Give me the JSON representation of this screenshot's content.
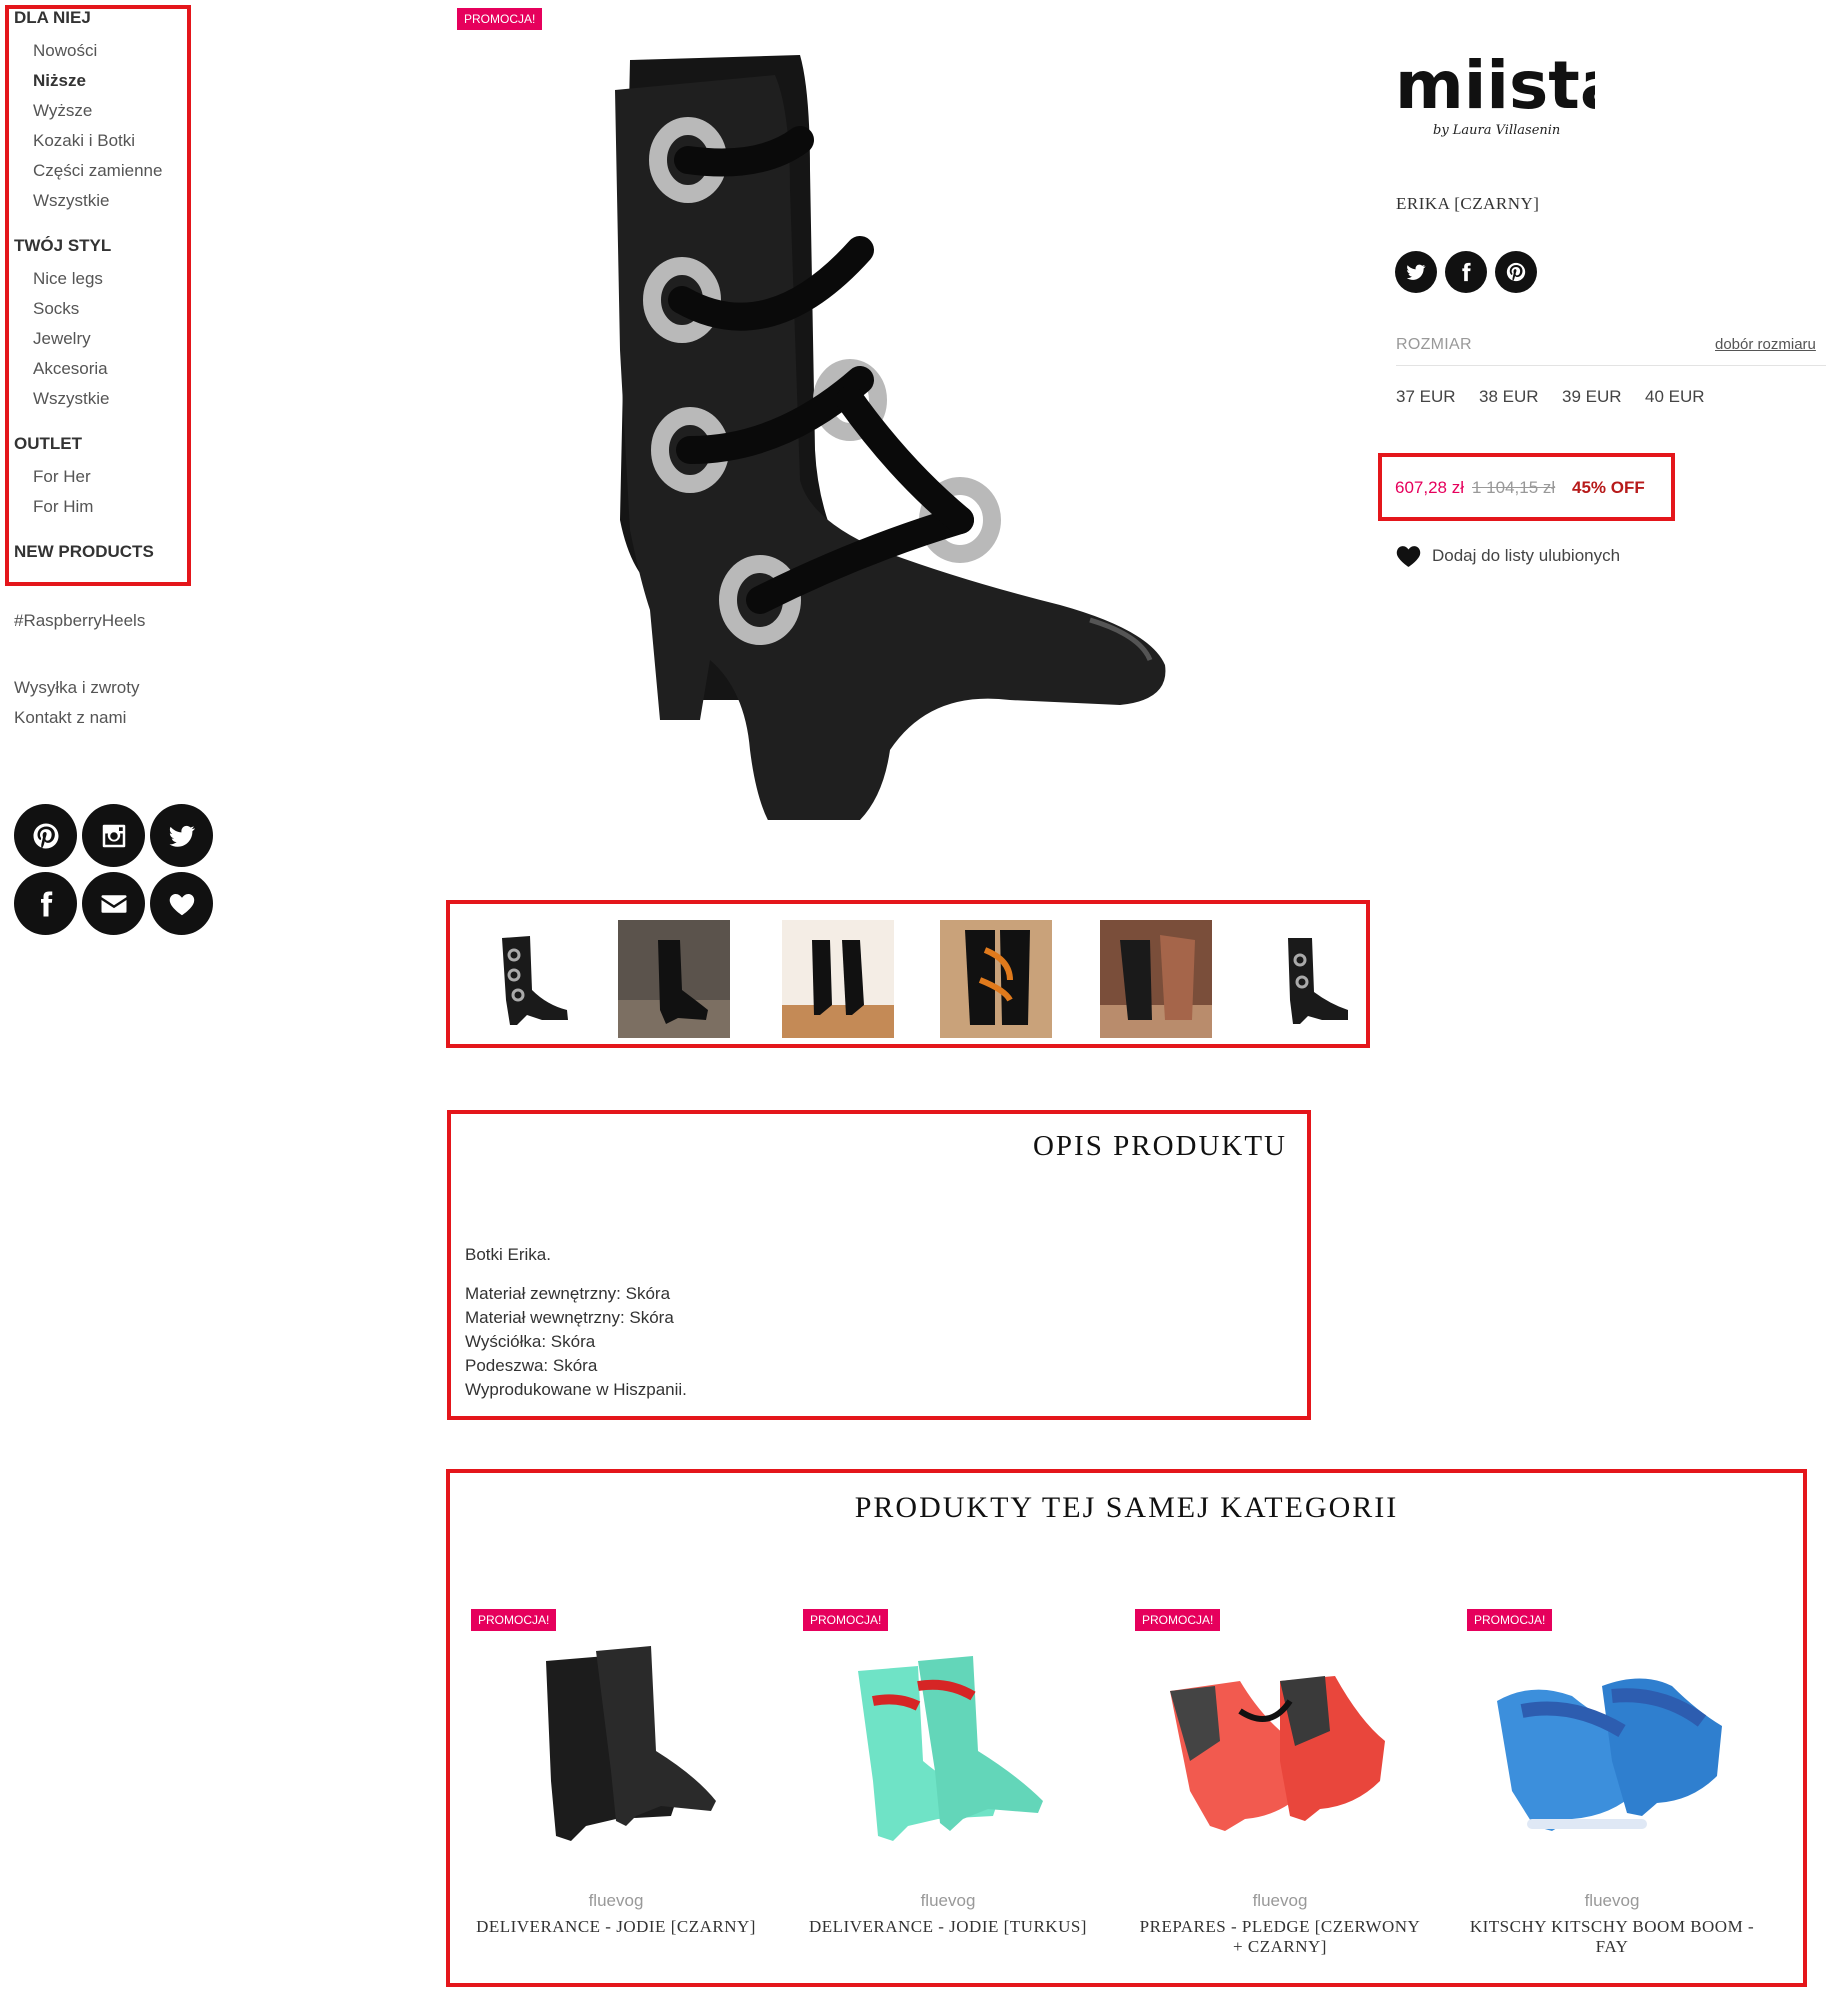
{
  "sidebar": {
    "sections": [
      {
        "heading": "DLA NIEJ",
        "items": [
          "Nowości",
          "Niższe",
          "Wyższe",
          "Kozaki i Botki",
          "Części zamienne",
          "Wszystkie"
        ],
        "active_index": 1
      },
      {
        "heading": "TWÓJ STYL",
        "items": [
          "Nice legs",
          "Socks",
          "Jewelry",
          "Akcesoria",
          "Wszystkie"
        ]
      },
      {
        "heading": "OUTLET",
        "items": [
          "For Her",
          "For Him"
        ]
      },
      {
        "heading": "NEW PRODUCTS",
        "items": []
      }
    ],
    "hashtag": "#RaspberryHeels",
    "links": [
      "Wysyłka i zwroty",
      "Kontakt z nami"
    ],
    "social_icons": [
      "pinterest-icon",
      "instagram-icon",
      "twitter-icon",
      "facebook-icon",
      "envelope-icon",
      "heart-icon"
    ]
  },
  "product": {
    "badge": "PROMOCJA!",
    "brand_logo": {
      "name": "miista",
      "tagline": "by Laura Villasenin"
    },
    "name": "ERIKA [CZARNY]",
    "share_icons": [
      "twitter-icon",
      "facebook-icon",
      "pinterest-icon"
    ],
    "size_label": "ROZMIAR",
    "size_guide": "dobór rozmiaru",
    "sizes": [
      "37 EUR",
      "38 EUR",
      "39 EUR",
      "40 EUR"
    ],
    "price_now": "607,28 zł",
    "price_old": "1 104,15 zł",
    "discount": "45% OFF",
    "wishlist": "Dodaj do listy ulubionych",
    "thumbnails": 6
  },
  "description": {
    "title": "OPIS PRODUKTU",
    "lead": "Botki Erika.",
    "lines": [
      "Materiał zewnętrzny: Skóra",
      "Materiał wewnętrzny: Skóra",
      "Wyściółka: Skóra",
      "Podeszwa: Skóra",
      "Wyprodukowane w Hiszpanii."
    ]
  },
  "related": {
    "title": "PRODUKTY TEJ SAMEJ KATEGORII",
    "items": [
      {
        "badge": "PROMOCJA!",
        "brand": "fluevog",
        "name": "DELIVERANCE - JODIE [CZARNY]",
        "color": "#1c1c1c"
      },
      {
        "badge": "PROMOCJA!",
        "brand": "fluevog",
        "name": "DELIVERANCE - JODIE [TURKUS]",
        "color": "#6fe3c6"
      },
      {
        "badge": "PROMOCJA!",
        "brand": "fluevog",
        "name": "PREPARES - PLEDGE [CZERWONY + CZARNY]",
        "color": "#f25a4f"
      },
      {
        "badge": "PROMOCJA!",
        "brand": "fluevog",
        "name": "KITSCHY KITSCHY BOOM BOOM - FAY",
        "color": "#3c8fdc"
      }
    ]
  }
}
